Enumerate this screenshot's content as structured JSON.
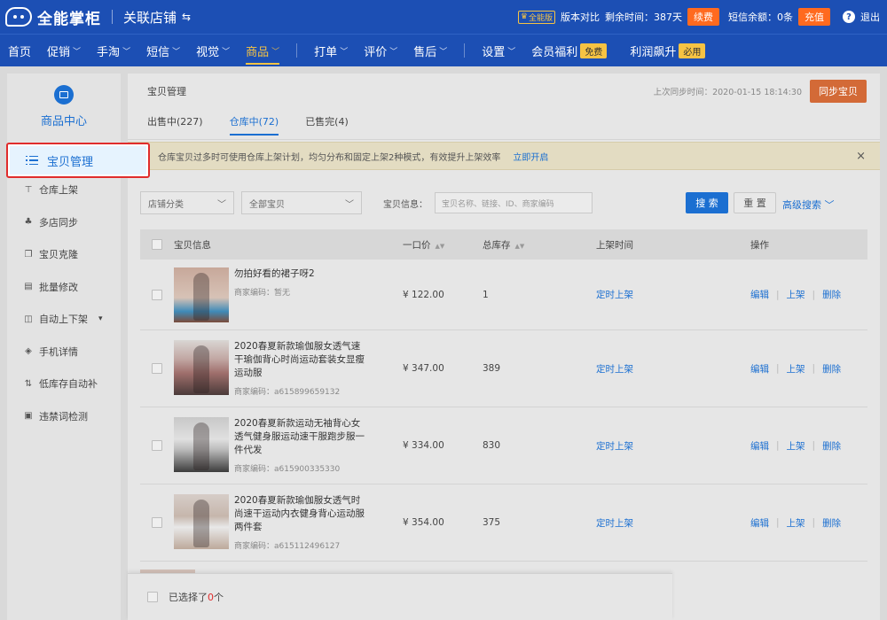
{
  "header": {
    "app_name": "全能掌柜",
    "shop_name": "关联店铺",
    "version_badge": "全能版",
    "compare_label": "版本对比",
    "remaining_label": "剩余时间：",
    "remaining_value": "387天",
    "renew_label": "续费",
    "sms_label": "短信余额：",
    "sms_value": "0条",
    "recharge_label": "充值",
    "help_glyph": "?",
    "logout_label": "退出"
  },
  "nav": {
    "items": [
      {
        "label": "首页",
        "has_dropdown": false
      },
      {
        "label": "促销",
        "has_dropdown": true
      },
      {
        "label": "手淘",
        "has_dropdown": true
      },
      {
        "label": "短信",
        "has_dropdown": true
      },
      {
        "label": "视觉",
        "has_dropdown": true
      },
      {
        "label": "商品",
        "has_dropdown": true,
        "active": true
      },
      {
        "label": "打单",
        "has_dropdown": true
      },
      {
        "label": "评价",
        "has_dropdown": true
      },
      {
        "label": "售后",
        "has_dropdown": true
      },
      {
        "label": "设置",
        "has_dropdown": true
      },
      {
        "label": "会员福利",
        "badge": "免费"
      },
      {
        "label": "利润飙升",
        "badge": "必用"
      }
    ]
  },
  "sidebar": {
    "section_title": "商品中心",
    "active_item": "宝贝管理",
    "items": [
      {
        "label": "仓库上架",
        "icon": "upload-icon"
      },
      {
        "label": "多店同步",
        "icon": "sync-stores-icon"
      },
      {
        "label": "宝贝克隆",
        "icon": "clone-icon"
      },
      {
        "label": "批量修改",
        "icon": "batch-edit-icon"
      },
      {
        "label": "自动上下架",
        "icon": "auto-list-icon",
        "has_dropdown": true
      },
      {
        "label": "手机详情",
        "icon": "mobile-detail-icon"
      },
      {
        "label": "低库存自动补",
        "icon": "restock-icon"
      },
      {
        "label": "违禁词检测",
        "icon": "forbidden-word-icon"
      }
    ]
  },
  "main": {
    "title": "宝贝管理",
    "sync_time": "上次同步时间：2020-01-15 18:14:30",
    "sync_button": "同步宝贝",
    "tabs": [
      {
        "label": "出售中(227)"
      },
      {
        "label": "仓库中(72)",
        "active": true
      },
      {
        "label": "已售完(4)"
      }
    ],
    "notice": {
      "text": "仓库宝贝过多时可使用仓库上架计划，均匀分布和固定上架2种模式，有效提升上架效率",
      "link": "立即开启",
      "close": "×"
    },
    "filters": {
      "shop_category": "店铺分类",
      "all_items": "全部宝贝",
      "info_label": "宝贝信息：",
      "search_placeholder": "宝贝名称、链接、ID、商家编码",
      "search_button": "搜 索",
      "reset_button": "重 置",
      "advanced_search": "高级搜索"
    },
    "table": {
      "columns": {
        "info": "宝贝信息",
        "price": "一口价",
        "stock": "总库存",
        "list_time": "上架时间",
        "ops": "操作"
      },
      "rows": [
        {
          "name": "勿拍好看的裙子呀2",
          "code": "商家编码：暂无",
          "price": "¥ 122.00",
          "stock": "1",
          "list_time": "定时上架",
          "op_edit": "编辑",
          "op_list": "上架",
          "op_delete": "删除"
        },
        {
          "name": "2020春夏新款瑜伽服女透气速干瑜伽背心时尚运动套装女显瘦运动服",
          "code": "商家编码：a615899659132",
          "price": "¥ 347.00",
          "stock": "389",
          "list_time": "定时上架",
          "op_edit": "编辑",
          "op_list": "上架",
          "op_delete": "删除"
        },
        {
          "name": "2020春夏新款运动无袖背心女透气健身服运动速干服跑步服一件代发",
          "code": "商家编码：a615900335330",
          "price": "¥ 334.00",
          "stock": "830",
          "list_time": "定时上架",
          "op_edit": "编辑",
          "op_list": "上架",
          "op_delete": "删除"
        },
        {
          "name": "2020春夏新款瑜伽服女透气时尚速干运动内衣健身背心运动服两件套",
          "code": "商家编码：a615112496127",
          "price": "¥ 354.00",
          "stock": "375",
          "list_time": "定时上架",
          "op_edit": "编辑",
          "op_list": "上架",
          "op_delete": "删除"
        }
      ]
    },
    "footer": {
      "selected_prefix": "已选择了",
      "selected_count": "0",
      "selected_suffix": "个"
    }
  },
  "colors": {
    "brand_blue": "#1c4fb4",
    "link_blue": "#1b6fd1",
    "accent_yellow": "#f6c343",
    "orange": "#ff6a1f",
    "highlight_red": "#e02c2c"
  }
}
